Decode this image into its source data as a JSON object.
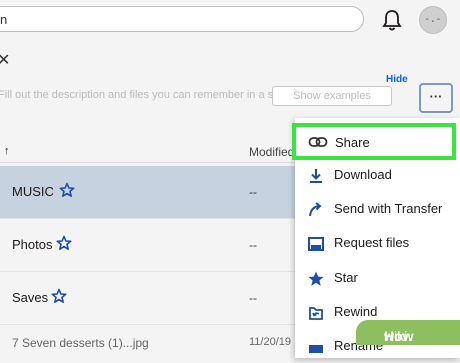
{
  "topbar": {
    "search_text": "n"
  },
  "panel": {
    "close_glyph": "✕",
    "hide_label": "Hide",
    "description": "Fill out the description and files you can remember in a space.",
    "show_examples_label": "Show examples",
    "more_label": "···"
  },
  "table": {
    "sort_arrow": "↑",
    "modified_header": "Modified",
    "rows": [
      {
        "name": "MUSIC",
        "modified": "--",
        "starred": true,
        "selected": true
      },
      {
        "name": "Photos",
        "modified": "--",
        "starred": true,
        "selected": false
      },
      {
        "name": "Saves",
        "modified": "--",
        "starred": true,
        "selected": false
      },
      {
        "name": "7 Seven desserts (1)...jpg",
        "modified": "11/20/19",
        "starred": false,
        "selected": false
      }
    ]
  },
  "menu": {
    "highlighted": "Share",
    "items": [
      {
        "label": "Share",
        "icon": "link-icon"
      },
      {
        "label": "Download",
        "icon": "download-icon"
      },
      {
        "label": "Send with Transfer",
        "icon": "send-arrow-icon"
      },
      {
        "label": "Request files",
        "icon": "request-files-icon"
      },
      {
        "label": "Star",
        "icon": "star-icon"
      },
      {
        "label": "Rewind",
        "icon": "rewind-icon"
      },
      {
        "label": "Rename",
        "icon": "rename-icon"
      }
    ]
  },
  "watermark": {
    "wiki": "wiki",
    "how": "How"
  },
  "colors": {
    "accent": "#0061fe",
    "highlight_border": "#35e83b",
    "selected_row": "#c7d2e0",
    "watermark_bg": "#8dbe5f"
  }
}
